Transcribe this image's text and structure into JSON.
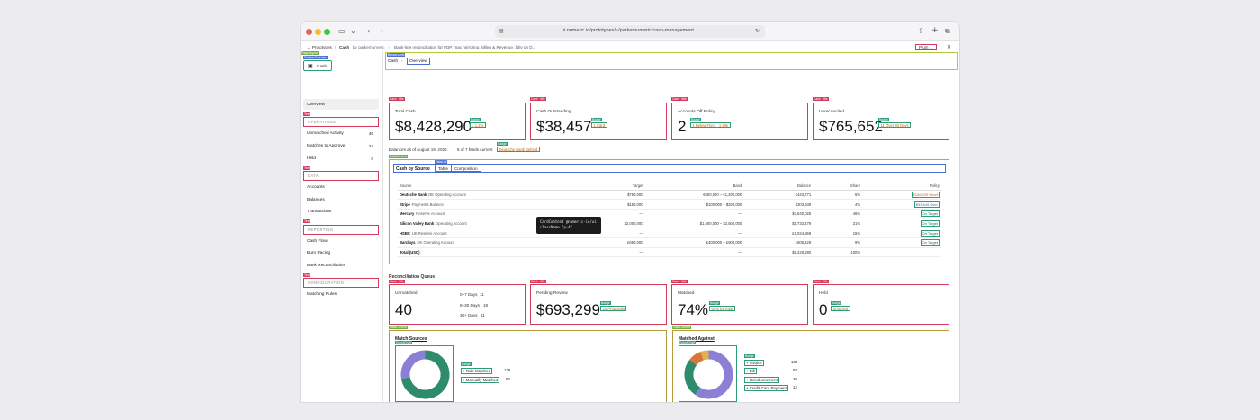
{
  "browser": {
    "url": "ui.numeric.io/prototypes/~/parkernumeric/cash-management"
  },
  "topbar": {
    "back": "← Prototypes",
    "sep": "/",
    "project": "Cash",
    "owner": "by parkernumeric",
    "arrow": "›",
    "description": "Bank-line reconciliation for FDP, max mirroring Billing & Revenue, fully on D...",
    "user": "Plum"
  },
  "dev_tags": {
    "sidebar_root": "PageLayout",
    "sidebar_header": "SidebarSwitcher",
    "text": "Text",
    "breadcrumb": "Breadcrumb",
    "card": "Card · title",
    "badge": "Badge",
    "data_card": "DataContent",
    "tabs": "TabsList",
    "donut": "DonutChart"
  },
  "sidebar": {
    "switcher_label": "Cash",
    "overview": "Overview",
    "sections": [
      {
        "title": "OPERATIONS",
        "items": [
          {
            "label": "Unmatched Activity",
            "count": "49"
          },
          {
            "label": "Matches to Approve",
            "count": "24"
          },
          {
            "label": "Held",
            "count": "0"
          }
        ]
      },
      {
        "title": "DATA",
        "items": [
          {
            "label": "Accounts"
          },
          {
            "label": "Balances"
          },
          {
            "label": "Transactions"
          }
        ]
      },
      {
        "title": "REPORTING",
        "items": [
          {
            "label": "Cash Flow"
          },
          {
            "label": "Burn Pacing"
          },
          {
            "label": "Bank Reconciliation"
          }
        ]
      },
      {
        "title": "CONFIGURATION",
        "items": [
          {
            "label": "Matching Rules"
          }
        ]
      }
    ]
  },
  "breadcrumb": {
    "items": [
      "Cash",
      "Overview"
    ],
    "sep": "›"
  },
  "kpis": [
    {
      "label": "Total Cash",
      "value": "$8,428,290",
      "badge": "↓ 1.2%"
    },
    {
      "label": "Cash Outstanding",
      "value": "$38,457",
      "badge": "1 Card"
    },
    {
      "label": "Accounts Off Policy",
      "value": "2",
      "badge": "1 Below Floor · 1 Idle"
    },
    {
      "label": "Unreconciled",
      "value": "$765,652",
      "badge": "11 Over 30 Days"
    }
  ],
  "status": {
    "balances": "Balances as of August 19, 2026",
    "dot": "·",
    "feeds": "6 of 7 feeds current",
    "alert": "Deutsche Bank Behind"
  },
  "cash_by_source": {
    "title": "Cash by Source",
    "tabs": [
      "Table",
      "Composition"
    ],
    "columns": [
      "Source",
      "Target",
      "Band",
      "Balance",
      "Share",
      "Policy"
    ],
    "rows": [
      {
        "name": "Deutsche Bank",
        "account": "DE Operating Account",
        "target": "$750,000",
        "band": "€600,000 – €1,200,000",
        "balance": "€443,771",
        "share": "6%",
        "policy": "€156,229 Short",
        "kind": "warn"
      },
      {
        "name": "Stripe",
        "account": "Payments Balance",
        "target": "$150,000",
        "band": "$100,000 – $200,000",
        "balance": "$303,649",
        "share": "4%",
        "policy": "$53,649 Over",
        "kind": "info"
      },
      {
        "name": "Mercury",
        "account": "Reserve Account",
        "target": "—",
        "band": "—",
        "balance": "$3,640,025",
        "share": "46%",
        "policy": "On Target",
        "kind": "ok"
      },
      {
        "name": "Silicon Valley Bank",
        "account": "Operating Account",
        "target": "$2,000,000",
        "band": "$1,600,000 – $2,500,000",
        "balance": "$1,733,479",
        "share": "21%",
        "policy": "On Target",
        "kind": "ok"
      },
      {
        "name": "HSBC",
        "account": "UK Reserve Account",
        "target": "—",
        "band": "—",
        "balance": "£1,024,969",
        "share": "15%",
        "policy": "On Target",
        "kind": "ok"
      },
      {
        "name": "Barclays",
        "account": "UK Operating Account",
        "target": "£650,000",
        "band": "£400,000 – £900,000",
        "balance": "£606,429",
        "share": "9%",
        "policy": "On Target",
        "kind": "ok"
      },
      {
        "name": "Total (USD)",
        "account": "",
        "target": "—",
        "band": "—",
        "balance": "$8,428,290",
        "share": "100%",
        "policy": "",
        "kind": ""
      }
    ]
  },
  "tooltip": {
    "line1": "CardContent @numeric-io/ui",
    "line2": "className \"p-4\""
  },
  "recon": {
    "title": "Reconciliation Queue",
    "unmatched": {
      "label": "Unmatched",
      "value": "40",
      "aging": [
        {
          "label": "0–7 Days",
          "value": "11"
        },
        {
          "label": "8–30 Days",
          "value": "18"
        },
        {
          "label": "30+ Days",
          "value": "11"
        }
      ]
    },
    "pending": {
      "label": "Pending Review",
      "value": "$693,299",
      "badge": "34 Proposals"
    },
    "matched": {
      "label": "Matched",
      "value": "74%",
      "badge": "64% by Rule"
    },
    "held": {
      "label": "Held",
      "value": "0",
      "badge": "Snoozed"
    }
  },
  "match_sources": {
    "title": "Match Sources",
    "legend": [
      {
        "label": "Rule Matched",
        "value": "136",
        "color": "#2e8b6b"
      },
      {
        "label": "Manually Matched",
        "value": "52",
        "color": "#8b7fd6"
      }
    ]
  },
  "matched_against": {
    "title": "Matched Against",
    "legend": [
      {
        "label": "Invoice",
        "value": "132",
        "color": "#8b7fd6"
      },
      {
        "label": "Bill",
        "value": "58",
        "color": "#2e8b6b"
      },
      {
        "label": "Reimbursement",
        "value": "20",
        "color": "#d9743a"
      },
      {
        "label": "Credit Card Payment",
        "value": "12",
        "color": "#e0b04a"
      }
    ]
  },
  "colors": {
    "accent": "#d63a5b",
    "panel": "#b89a3c",
    "badge": "#2d9c79"
  }
}
